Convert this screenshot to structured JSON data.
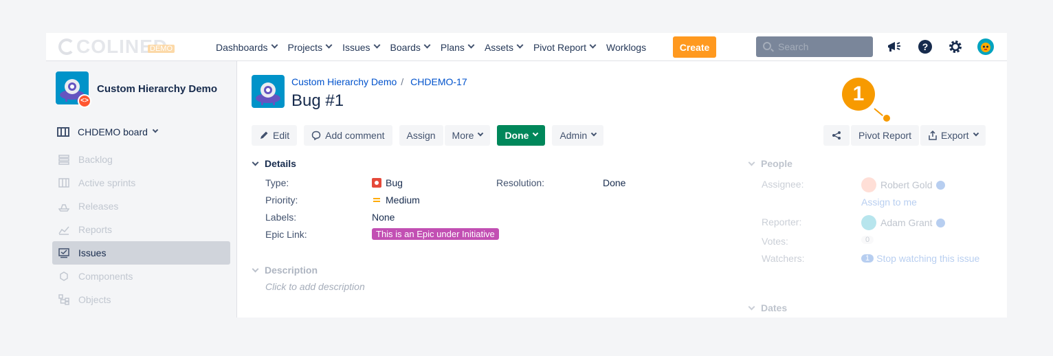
{
  "brand": {
    "logo_text": "COLINED",
    "logo_badge": "DEMO"
  },
  "nav": {
    "items": [
      {
        "label": "Dashboards",
        "dropdown": true
      },
      {
        "label": "Projects",
        "dropdown": true
      },
      {
        "label": "Issues",
        "dropdown": true
      },
      {
        "label": "Boards",
        "dropdown": true
      },
      {
        "label": "Plans",
        "dropdown": true
      },
      {
        "label": "Assets",
        "dropdown": true
      },
      {
        "label": "Pivot Report",
        "dropdown": true
      },
      {
        "label": "Worklogs",
        "dropdown": false
      }
    ],
    "create_label": "Create",
    "search_placeholder": "Search"
  },
  "sidebar": {
    "project_name": "Custom Hierarchy Demo",
    "board_label": "CHDEMO board",
    "items": [
      {
        "label": "Backlog",
        "icon": "backlog-icon"
      },
      {
        "label": "Active sprints",
        "icon": "sprints-icon"
      },
      {
        "label": "Releases",
        "icon": "releases-icon"
      },
      {
        "label": "Reports",
        "icon": "reports-icon"
      },
      {
        "label": "Issues",
        "icon": "issues-icon",
        "active": true
      },
      {
        "label": "Components",
        "icon": "components-icon"
      },
      {
        "label": "Objects",
        "icon": "objects-icon"
      }
    ]
  },
  "issue": {
    "breadcrumb_project": "Custom Hierarchy Demo",
    "breadcrumb_key": "CHDEMO-17",
    "breadcrumb_sep": "/",
    "title": "Bug #1"
  },
  "toolbar": {
    "edit": "Edit",
    "add_comment": "Add comment",
    "assign": "Assign",
    "more": "More",
    "done": "Done",
    "admin": "Admin",
    "pivot_report": "Pivot Report",
    "export": "Export"
  },
  "callout": {
    "number": "1"
  },
  "details": {
    "heading": "Details",
    "type_label": "Type:",
    "type_value": "Bug",
    "priority_label": "Priority:",
    "priority_value": "Medium",
    "labels_label": "Labels:",
    "labels_value": "None",
    "epic_label": "Epic Link:",
    "epic_value": "This is an Epic under Initiative",
    "resolution_label": "Resolution:",
    "resolution_value": "Done"
  },
  "description": {
    "heading": "Description",
    "placeholder": "Click to add description"
  },
  "people": {
    "heading": "People",
    "assignee_label": "Assignee:",
    "assignee_value": "Robert Gold",
    "assign_to_me": "Assign to me",
    "reporter_label": "Reporter:",
    "reporter_value": "Adam Grant",
    "votes_label": "Votes:",
    "votes_value": "0",
    "watchers_label": "Watchers:",
    "watchers_count": "1",
    "watchers_action": "Stop watching this issue"
  },
  "dates": {
    "heading": "Dates"
  },
  "colors": {
    "accent_orange": "#ff991f",
    "done_green": "#00875a",
    "link_blue": "#0052cc",
    "epic_magenta": "#c24fb3"
  }
}
